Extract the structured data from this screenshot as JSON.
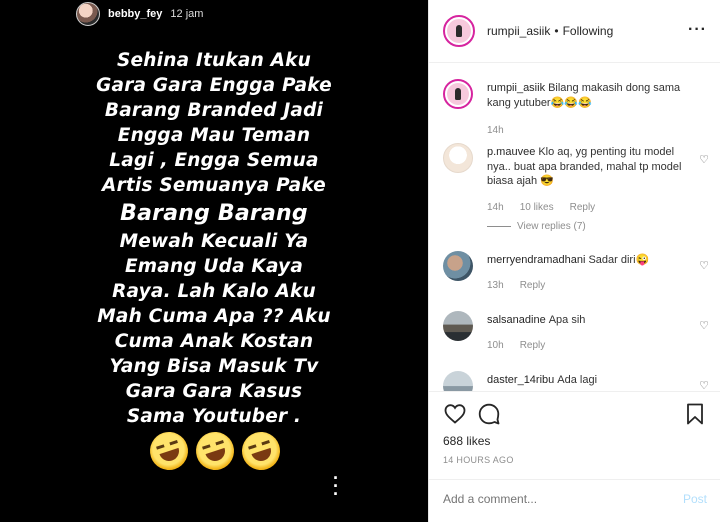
{
  "story": {
    "username": "bebby_fey",
    "time": "12 jam",
    "lines": [
      {
        "text": "Sehina Itukan Aku",
        "big": false
      },
      {
        "text": "Gara Gara Engga Pake",
        "big": false
      },
      {
        "text": "Barang Branded Jadi",
        "big": false
      },
      {
        "text": "Engga Mau Teman",
        "big": false
      },
      {
        "text": "Lagi , Engga Semua",
        "big": false
      },
      {
        "text": "Artis Semuanya Pake",
        "big": false
      },
      {
        "text": "Barang Barang",
        "big": true
      },
      {
        "text": "Mewah Kecuali Ya",
        "big": false
      },
      {
        "text": "Emang Uda Kaya",
        "big": false
      },
      {
        "text": "Raya.  Lah Kalo Aku",
        "big": false
      },
      {
        "text": "Mah Cuma Apa ?? Aku",
        "big": false
      },
      {
        "text": "Cuma Anak Kostan",
        "big": false
      },
      {
        "text": "Yang Bisa Masuk Tv",
        "big": false
      },
      {
        "text": "Gara Gara Kasus",
        "big": false
      },
      {
        "text": "Sama Youtuber .",
        "big": false
      }
    ],
    "emoji_count": 3,
    "more_icon": "vertical-dots-icon"
  },
  "header": {
    "username": "rumpii_asiik",
    "separator": "•",
    "follow_status": "Following",
    "more": "···"
  },
  "comments": [
    {
      "username": "rumpii_asiik",
      "text": "Bilang makasih dong sama kang yutuber😂😂😂",
      "time": "14h",
      "likes": "",
      "reply": "",
      "view_replies": ""
    },
    {
      "username": "p.mauvee",
      "text": "Klo aq, yg penting itu model nya.. buat apa branded, mahal tp model biasa ajah 😎",
      "time": "14h",
      "likes": "10 likes",
      "reply": "Reply",
      "view_replies": "View replies (7)"
    },
    {
      "username": "merryendramadhani",
      "text": "Sadar diri😜",
      "time": "13h",
      "likes": "",
      "reply": "Reply",
      "view_replies": ""
    },
    {
      "username": "salsanadine",
      "text": "Apa sih",
      "time": "10h",
      "likes": "",
      "reply": "Reply",
      "view_replies": ""
    },
    {
      "username": "daster_14ribu",
      "text": "Ada lagi",
      "time": "",
      "likes": "",
      "reply": "",
      "view_replies": ""
    }
  ],
  "actions": {
    "likes": "688 likes",
    "time": "14 HOURS AGO"
  },
  "add_comment": {
    "placeholder": "Add a comment...",
    "post_label": "Post"
  },
  "colors": {
    "story_ring": "#d6249f",
    "post_button": "#b2dffc",
    "meta_text": "#8e8e8e"
  }
}
